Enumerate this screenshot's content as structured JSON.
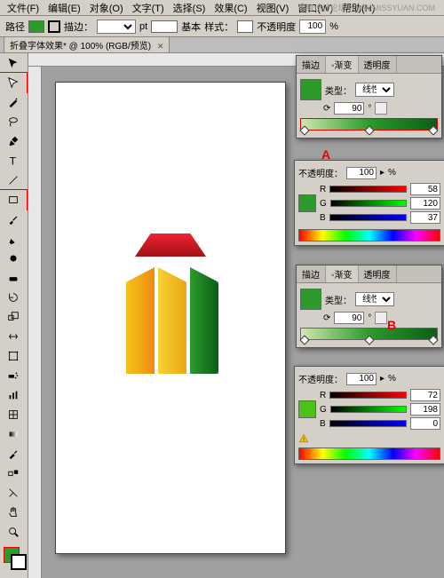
{
  "watermark": "思缘设计论坛   WWW.MISSYUAN.COM",
  "menubar": [
    "文件(F)",
    "编辑(E)",
    "对象(O)",
    "文字(T)",
    "选择(S)",
    "效果(C)",
    "视图(V)",
    "窗口(W)",
    "帮助(H)"
  ],
  "optbar": {
    "path_label": "路径",
    "stroke_label": "描边：",
    "stroke_pt": "pt",
    "basic_label": "基本",
    "style_label": "样式：",
    "opacity_label": "不透明度",
    "opacity_value": "100",
    "opacity_unit": "%"
  },
  "doc_tab": {
    "label": "折叠字体效果* @ 100% (RGB/预览)"
  },
  "toolbar_icons": [
    "selection",
    "direct-selection",
    "magic-wand",
    "lasso",
    "pen",
    "type",
    "line",
    "rectangle",
    "brush",
    "pencil",
    "blob",
    "eraser",
    "rotate",
    "scale",
    "warp",
    "free-transform",
    "symbol-sprayer",
    "graph",
    "mesh",
    "gradient",
    "eyedropper",
    "blend",
    "slice",
    "artboard",
    "hand",
    "zoom"
  ],
  "toolbar_selected_index": 1,
  "toolbar_rect_index": 7,
  "callouts": {
    "A": "A",
    "B": "B"
  },
  "panels": {
    "gradientA": {
      "tabs": [
        "描边",
        "◦渐变",
        "透明度"
      ],
      "active_tab": 1,
      "type_label": "类型：",
      "type_value": "线性",
      "angle": "90",
      "angle_unit": "°"
    },
    "colorA": {
      "opacity_label": "不透明度：",
      "opacity_value": "100",
      "opacity_unit": "%",
      "R_label": "R",
      "R_value": "58",
      "G_label": "G",
      "G_value": "120",
      "B_label": "B",
      "B_value": "37"
    },
    "gradientB": {
      "tabs": [
        "描边",
        "◦渐变",
        "透明度"
      ],
      "active_tab": 1,
      "type_label": "类型：",
      "type_value": "线性",
      "angle": "90",
      "angle_unit": "°"
    },
    "colorB": {
      "opacity_label": "不透明度：",
      "opacity_value": "100",
      "opacity_unit": "%",
      "R_label": "R",
      "R_value": "72",
      "G_label": "G",
      "G_value": "198",
      "B_label": "B",
      "B_value": "0"
    }
  },
  "colors": {
    "fill": "#2b9b2b",
    "roof1": "#e23",
    "roof2": "#a01215",
    "yellow1": "#f6c31b",
    "yellow2": "#f08b12",
    "yellow3": "#f7d235",
    "yellow4": "#eaa714",
    "green1": "#2b9b2b",
    "green2": "#0d5d16"
  }
}
